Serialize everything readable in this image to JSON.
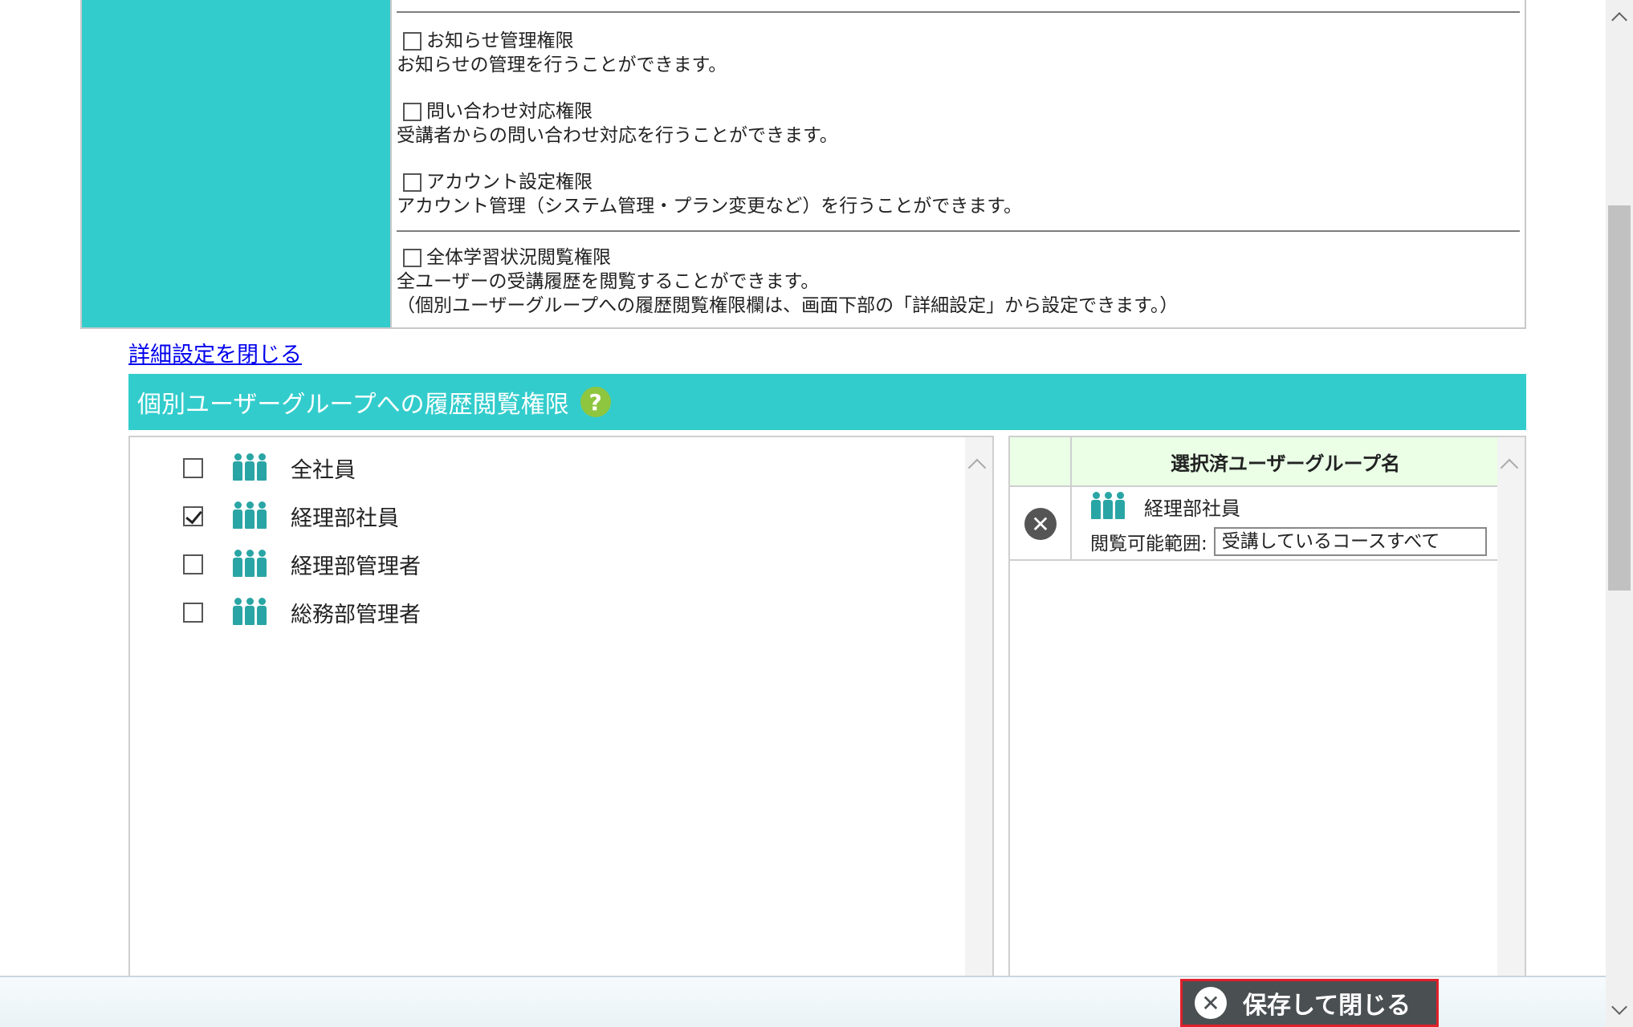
{
  "permissions": [
    {
      "label": "お知らせ管理権限",
      "desc": "お知らせの管理を行うことができます。"
    },
    {
      "label": "問い合わせ対応権限",
      "desc": "受講者からの問い合わせ対応を行うことができます。"
    },
    {
      "label": "アカウント設定権限",
      "desc": "アカウント管理（システム管理・プラン変更など）を行うことができます。"
    },
    {
      "label": "全体学習状況閲覧権限",
      "desc": "全ユーザーの受講履歴を閲覧することができます。",
      "desc2": "（個別ユーザーグループへの履歴閲覧権限欄は、画面下部の「詳細設定」から設定できます。）"
    }
  ],
  "detail_link": "詳細設定を閉じる",
  "section": {
    "title": "個別ユーザーグループへの履歴閲覧権限",
    "help": "?"
  },
  "groups": [
    {
      "name": "全社員",
      "checked": false
    },
    {
      "name": "経理部社員",
      "checked": true
    },
    {
      "name": "経理部管理者",
      "checked": false
    },
    {
      "name": "総務部管理者",
      "checked": false
    }
  ],
  "selected": {
    "header": "選択済ユーザーグループ名",
    "rows": [
      {
        "name": "経理部社員",
        "range_label": "閲覧可能範囲:",
        "range_value": "受講しているコースすべて"
      }
    ]
  },
  "footer": {
    "save_close": "保存して閉じる"
  },
  "colors": {
    "teal": "#33cccc",
    "help": "#8ec63f",
    "save_border": "#e0202a"
  }
}
